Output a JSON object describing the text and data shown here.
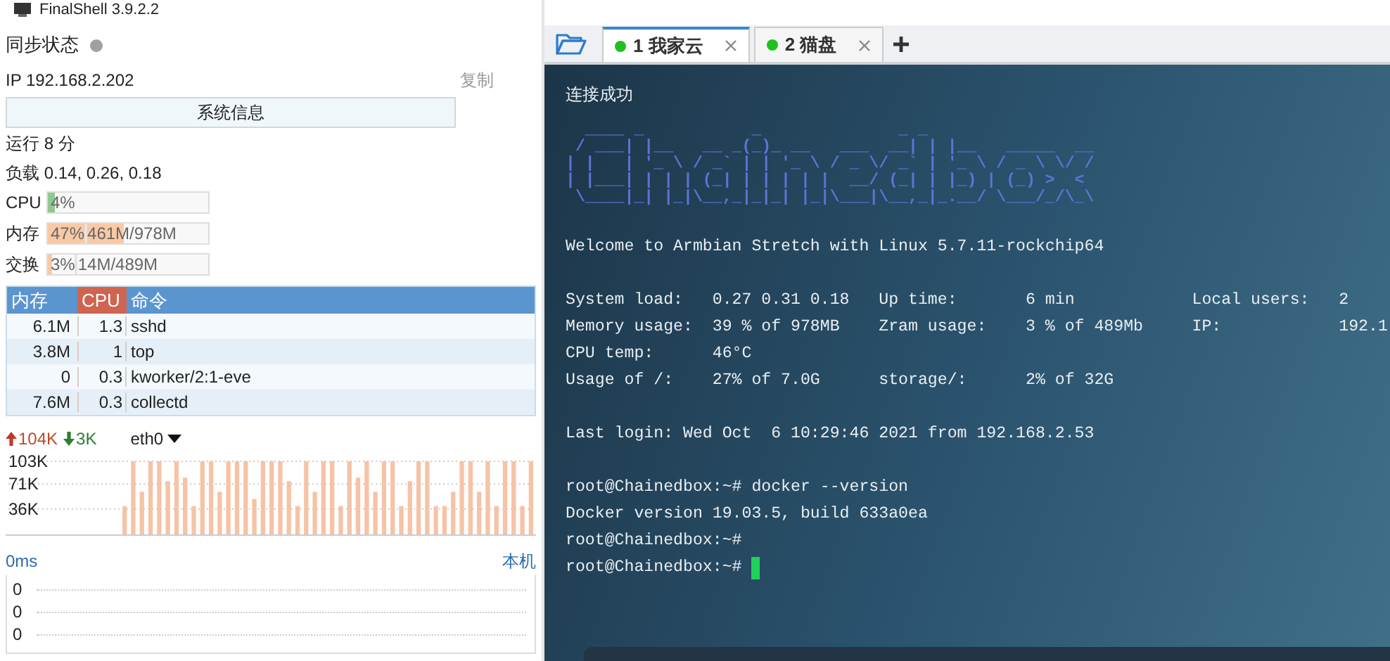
{
  "window": {
    "title": "FinalShell 3.9.2.2"
  },
  "sidebar": {
    "sync_label": "同步状态",
    "sync_on": false,
    "ip": "IP 192.168.2.202",
    "copy_link": "复制",
    "sysinfo_button": "系统信息",
    "uptime": "运行 8 分",
    "load": "负载 0.14, 0.26, 0.18",
    "meters": [
      {
        "label": "CPU",
        "percent": "4%",
        "level": 0.04,
        "color": "#8fc98f"
      },
      {
        "label": "内存",
        "percent": "47%",
        "detail": "461M/978M",
        "level": 0.47,
        "color": "#f9c9a5"
      },
      {
        "label": "交换",
        "percent": "3%",
        "detail": "14M/489M",
        "level": 0.03,
        "color": "#f9c9a5"
      }
    ],
    "process_table": {
      "columns": [
        {
          "label": "内存",
          "sorted": false
        },
        {
          "label": "CPU",
          "sorted": true
        },
        {
          "label": "命令",
          "sorted": false
        }
      ],
      "rows": [
        [
          "6.1M",
          "1.3",
          "sshd"
        ],
        [
          "3.8M",
          "1",
          "top"
        ],
        [
          "0",
          "0.3",
          "kworker/2:1-eve"
        ],
        [
          "7.6M",
          "0.3",
          "collectd"
        ]
      ]
    },
    "network": {
      "upload": "104K",
      "download": "3K",
      "interface": "eth0",
      "chart_data": {
        "type": "bar",
        "grid": true,
        "ylim": [
          0,
          103
        ],
        "yticks": [
          {
            "value": 103,
            "label": "103K"
          },
          {
            "value": 71,
            "label": "71K"
          },
          {
            "value": 36,
            "label": "36K"
          }
        ],
        "series": [
          {
            "color": "#f6c3a6",
            "values": [
              40,
              103,
              60,
              103,
              103,
              75,
              103,
              80,
              40,
              103,
              103,
              60,
              103,
              103,
              103,
              50,
              103,
              103,
              103,
              75,
              40,
              103,
              60,
              103,
              103,
              40,
              103,
              80,
              103,
              60,
              103,
              103,
              40,
              75,
              103,
              103,
              40,
              40,
              60,
              103,
              103,
              60,
              103,
              40,
              103,
              103,
              40,
              103
            ]
          }
        ]
      }
    },
    "latency": {
      "value": "0ms",
      "host": "本机",
      "ticks": [
        "0",
        "0",
        "0"
      ]
    }
  },
  "tabs": [
    {
      "label": "1 我家云",
      "connected": true,
      "selected": true
    },
    {
      "label": "2 猫盘",
      "connected": true,
      "selected": false
    }
  ],
  "terminal": {
    "banner": "连接成功",
    "ascii_art": [
      "  ____ _           _              _ _",
      " / ___| |__   __ _(_)_ __   ___  __| | |__   _____  __",
      "| |   | '_ \\ / _` | | '_ \\ / _ \\/ _` | '_ \\ / _ \\ \\/ /",
      "| |___| | | | (_| | | | | |  __/ (_| | |_) | (_) >  <",
      " \\____|_| |_|\\__,_|_|_| |_|\\___|\\__,_|_.__/ \\___/_/\\_\\"
    ],
    "welcome": "Welcome to Armbian Stretch with Linux 5.7.11-rockchip64",
    "stats": [
      "System load:   0.27 0.31 0.18   Up time:       6 min            Local users:   2",
      "Memory usage:  39 % of 978MB    Zram usage:    3 % of 489Mb     IP:            192.1",
      "CPU temp:      46°C",
      "Usage of /:    27% of 7.0G      storage/:      2% of 32G"
    ],
    "last_login": "Last login: Wed Oct  6 10:29:46 2021 from 192.168.2.53",
    "session": [
      {
        "text": "root@Chainedbox:~# docker --version",
        "cursor": false
      },
      {
        "text": "Docker version 19.03.5, build 633a0ea",
        "cursor": false
      },
      {
        "text": "root@Chainedbox:~#",
        "cursor": false
      },
      {
        "text": "root@Chainedbox:~#",
        "cursor": true
      }
    ]
  }
}
